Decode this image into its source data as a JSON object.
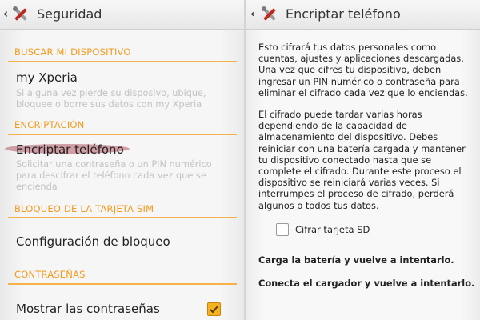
{
  "left": {
    "title": "Seguridad",
    "sections": {
      "buscar": "BUSCAR MI DISPOSITIVO",
      "encriptacion": "ENCRIPTACIÓN",
      "bloqueo_sim": "BLOQUEO DE LA TARJETA SIM",
      "contrasenas": "CONTRASEÑAS"
    },
    "items": {
      "my_xperia_title": "my Xperia",
      "my_xperia_sub": "Si alguna vez pierde su disposivo, ubique, bloquee o borre sus datos con my Xperia",
      "encriptar_title": "Encriptar teléfono",
      "encriptar_sub": "Solicitar una contraseña o un PIN numérico para descifrar el teléfono cada vez que se encienda",
      "config_bloqueo_title": "Configuración de bloqueo",
      "mostrar_contrasenas_title": "Mostrar las contraseñas",
      "mostrar_contrasenas_checked": true
    }
  },
  "right": {
    "title": "Encriptar teléfono",
    "paragraph1": "Esto cifrará tus datos personales como cuentas, ajustes y aplicaciones descargadas. Una vez que cifres tu dispositivo, deben ingresar un PIN numérico o contraseña para eliminar el cifrado cada vez que lo enciendas.",
    "paragraph2": "El cifrado puede tardar varias horas dependiendo de la capacidad de almacenamiento del dispositivo. Debes reiniciar con una batería cargada y mantener tu dispositivo conectado hasta que se complete el cifrado. Durante este proceso el dispositivo se reiniciará varias veces. Si interrumpes el proceso de cifrado, perderá algunos o todos tus datos.",
    "sd_label": "Cifrar tarjeta SD",
    "sd_checked": false,
    "msg_battery": "Carga la batería y vuelve a intentarlo.",
    "msg_charger": "Conecta el cargador y vuelve a intentarlo."
  },
  "colors": {
    "accent": "#f39a1c",
    "highlight": "#c98d96",
    "checkbox": "#f6b21c"
  },
  "icons": {
    "back": "chevron-left-icon",
    "settings": "settings-tools-icon",
    "check": "check-icon"
  }
}
